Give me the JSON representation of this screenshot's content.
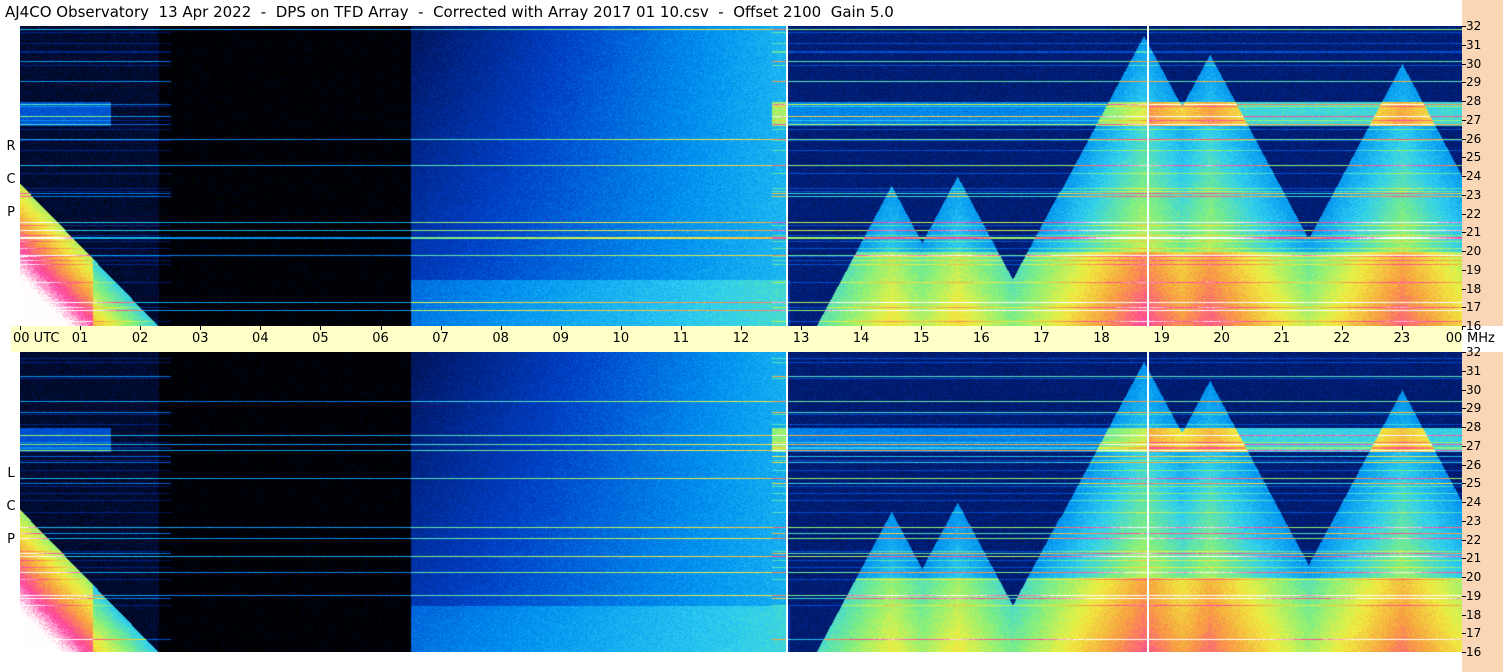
{
  "title": "AJ4CO Observatory  13 Apr 2022  -  DPS on TFD Array  -  Corrected with Array 2017 01 10.csv  -  Offset 2100  Gain 5.0",
  "panels": [
    {
      "id": "rcp",
      "label": [
        "R",
        "C",
        "P"
      ]
    },
    {
      "id": "lcp",
      "label": [
        "L",
        "C",
        "P"
      ]
    }
  ],
  "time_axis": {
    "labels": [
      "00 UTC",
      "01",
      "02",
      "03",
      "04",
      "05",
      "06",
      "07",
      "08",
      "09",
      "10",
      "11",
      "12",
      "13",
      "14",
      "15",
      "16",
      "17",
      "18",
      "19",
      "20",
      "21",
      "22",
      "23",
      "00"
    ],
    "unit": "UTC"
  },
  "freq_axis": {
    "labels": [
      "32",
      "31",
      "30",
      "29",
      "28",
      "27",
      "26",
      "25",
      "24",
      "23",
      "22",
      "21",
      "20",
      "19",
      "18",
      "17",
      "16"
    ],
    "unit_label": "MHz"
  },
  "chart_data": {
    "type": "heatmap",
    "title": "AJ4CO Observatory  13 Apr 2022  -  DPS on TFD Array  -  Corrected with Array 2017 01 10.csv  -  Offset 2100  Gain 5.0",
    "xlabel": "UTC",
    "ylabel": "MHz",
    "xlim": [
      0,
      24
    ],
    "ylim": [
      16,
      32
    ],
    "panels": [
      "RCP",
      "LCP"
    ],
    "colormap": [
      "#000000",
      "#001a6e",
      "#0040c8",
      "#0090f0",
      "#30d0f0",
      "#80f080",
      "#f0f040",
      "#f8a040",
      "#ff40a0",
      "#ffffff"
    ],
    "vertical_markers_utc": [
      12.75,
      18.75
    ],
    "features": [
      {
        "type": "bright-hump",
        "start_utc": 0.0,
        "end_utc": 2.2,
        "peak_mhz": 23.5
      },
      {
        "type": "ramp-up",
        "start_utc": 6.5,
        "end_utc": 12.7
      },
      {
        "type": "hump",
        "center_utc": 14.5,
        "peak_mhz": 23.5
      },
      {
        "type": "hump",
        "center_utc": 15.6,
        "peak_mhz": 24.0
      },
      {
        "type": "hump",
        "center_utc": 17.3,
        "peak_mhz": 23.2
      },
      {
        "type": "hump",
        "center_utc": 18.7,
        "peak_mhz": 31.5
      },
      {
        "type": "hump",
        "center_utc": 19.8,
        "peak_mhz": 30.5
      },
      {
        "type": "hump",
        "center_utc": 23.0,
        "peak_mhz": 30.0
      }
    ]
  }
}
